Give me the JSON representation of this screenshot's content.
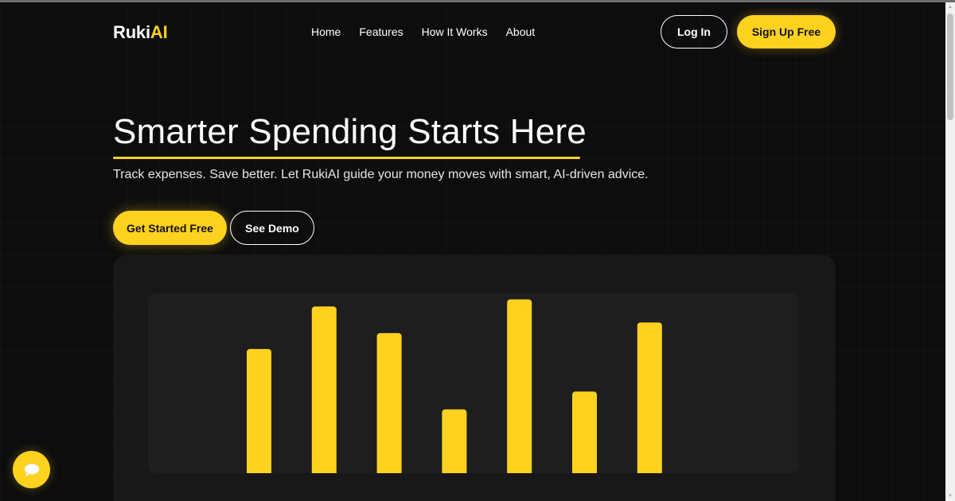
{
  "brand": {
    "name_main": "Ruki",
    "name_accent": "AI",
    "accent_color": "#ffd21f"
  },
  "nav": {
    "items": [
      {
        "label": "Home"
      },
      {
        "label": "Features"
      },
      {
        "label": "How It Works"
      },
      {
        "label": "About"
      }
    ]
  },
  "header": {
    "login_label": "Log In",
    "signup_label": "Sign Up Free"
  },
  "hero": {
    "title": "Smarter Spending Starts Here",
    "subtitle": "Track expenses. Save better. Let RukiAI guide your money moves with smart, AI-driven advice.",
    "primary_cta": "Get Started Free",
    "secondary_cta": "See Demo"
  },
  "chart_data": {
    "type": "bar",
    "categories": [
      "",
      "",
      "",
      "",
      "",
      "",
      ""
    ],
    "values": [
      70,
      94,
      79,
      36,
      98,
      46,
      85
    ],
    "ylim": [
      0,
      100
    ],
    "color": "#ffd21f",
    "grid": false
  },
  "chat": {
    "icon": "chat-bubble-icon"
  }
}
